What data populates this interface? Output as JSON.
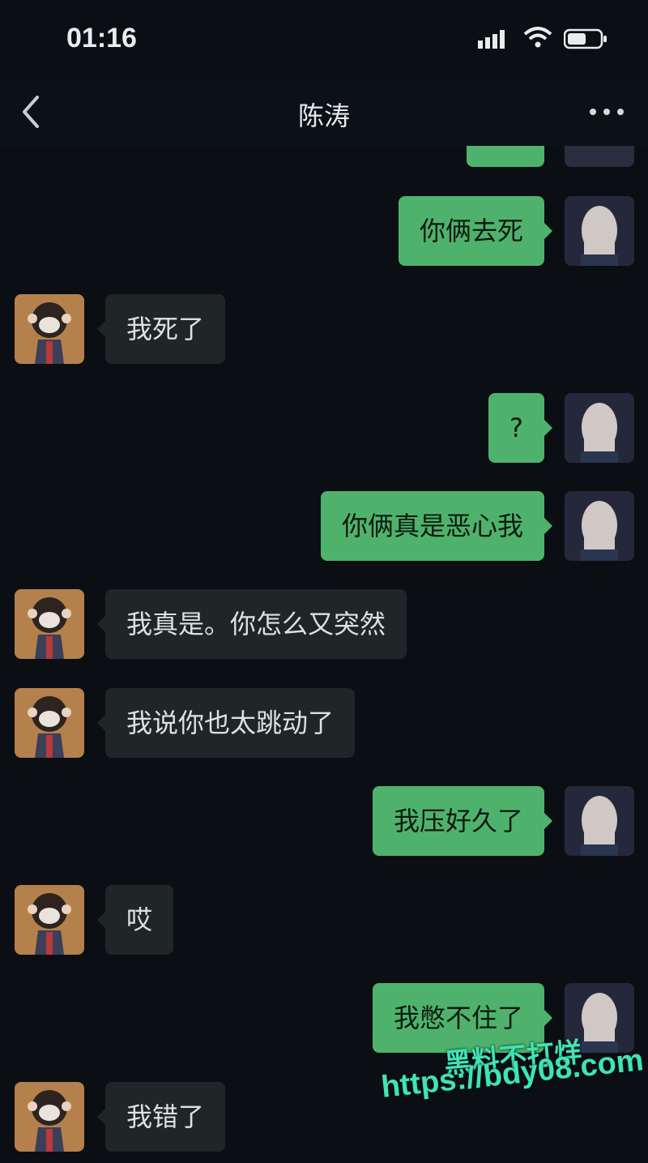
{
  "status_bar": {
    "time": "01:16",
    "signal_icon": "signal-icon",
    "wifi_icon": "wifi-icon",
    "battery_icon": "battery-icon"
  },
  "header": {
    "title": "陈涛",
    "back_icon": "chevron-left-icon",
    "more_icon": "more-dots-icon"
  },
  "messages": [
    {
      "side": "out",
      "text": "你俩去死"
    },
    {
      "side": "in",
      "text": "我死了"
    },
    {
      "side": "out",
      "text": "?"
    },
    {
      "side": "out",
      "text": "你俩真是恶心我"
    },
    {
      "side": "in",
      "text": "我真是。你怎么又突然"
    },
    {
      "side": "in",
      "text": "我说你也太跳动了"
    },
    {
      "side": "out",
      "text": "我压好久了"
    },
    {
      "side": "in",
      "text": "哎"
    },
    {
      "side": "out",
      "text": "我憋不住了"
    },
    {
      "side": "in",
      "text": "我错了"
    }
  ],
  "watermark": {
    "line1": "黑料不打烊",
    "line2": "https://bdy08.com"
  },
  "colors": {
    "background": "#0b0f14",
    "outgoing_bubble": "#4fb26c",
    "incoming_bubble": "#202528",
    "watermark": "#3fe4b2"
  }
}
